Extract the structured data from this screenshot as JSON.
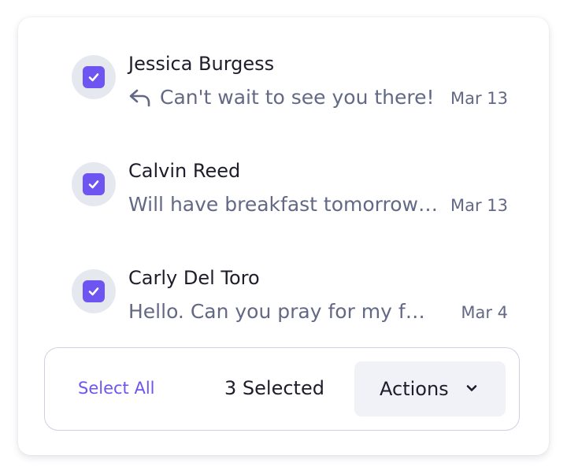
{
  "messages": [
    {
      "sender": "Jessica Burgess",
      "preview": "Can't wait to see you there!",
      "date": "Mar 13",
      "is_reply": true,
      "checked": true,
      "icon": "reply-icon"
    },
    {
      "sender": "Calvin Reed",
      "preview": "Will have breakfast tomorrow with the team",
      "date": "Mar 13",
      "is_reply": false,
      "checked": true
    },
    {
      "sender": "Carly Del Toro",
      "preview": "Hello. Can you pray for my family",
      "date": "Mar 4",
      "is_reply": false,
      "checked": true
    }
  ],
  "action_bar": {
    "select_all_label": "Select All",
    "selected_count_label": "3 Selected",
    "actions_label": "Actions",
    "actions_icon": "chevron-down-icon"
  },
  "colors": {
    "accent": "#6e55f2",
    "checkbox_halo": "#e6e8f0",
    "text_primary": "#1d1d2b",
    "text_secondary": "#636985",
    "button_bg": "#f1f2f7",
    "bar_border": "#cfd1e3"
  }
}
